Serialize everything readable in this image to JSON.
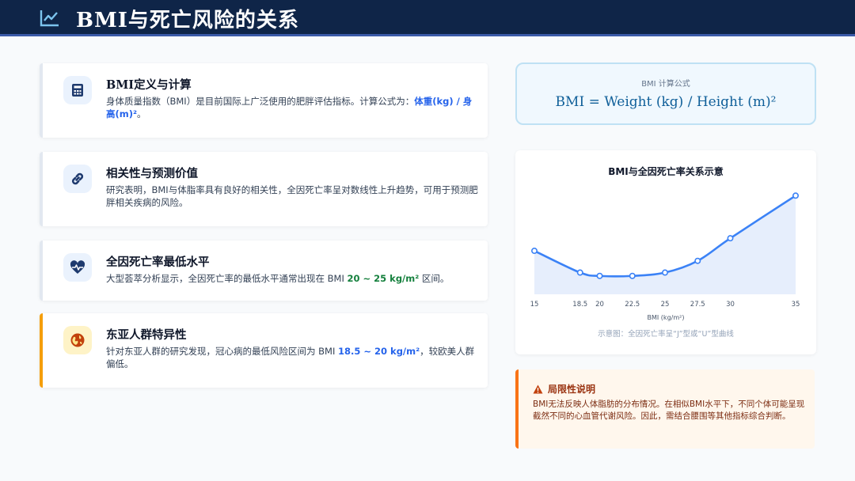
{
  "header": {
    "title": "BMI与死亡风险的关系",
    "icon": "chart-line-icon"
  },
  "cards": [
    {
      "icon": "calculator-icon",
      "title": "BMI定义与计算",
      "body_pre": "身体质量指数（BMI）是目前国际上广泛使用的肥胖评估指标。计算公式为：",
      "highlight": "体重(kg) / 身高(m)²",
      "body_post": "。"
    },
    {
      "icon": "link-icon",
      "title": "相关性与预测价值",
      "body": "研究表明，BMI与体脂率具有良好的相关性，全因死亡率呈对数线性上升趋势，可用于预测肥胖相关疾病的风险。"
    },
    {
      "icon": "heart-pulse-icon",
      "title": "全因死亡率最低水平",
      "body_pre": "大型荟萃分析显示，全因死亡率的最低水平通常出现在 BMI ",
      "highlight": "20 ~ 25 kg/m²",
      "body_post": " 区间。"
    },
    {
      "icon": "globe-asia-icon",
      "title": "东亚人群特异性",
      "body_pre": "针对东亚人群的研究发现，冠心病的最低风险区间为 BMI ",
      "highlight": "18.5 ~ 20 kg/m²",
      "body_post": "，较欧美人群偏低。"
    }
  ],
  "formula": {
    "label": "BMI 计算公式",
    "text": "BMI = Weight (kg) / Height (m)²"
  },
  "chart_data": {
    "type": "line",
    "title": "BMI与全因死亡率关系示意",
    "xlabel": "BMI (kg/m²)",
    "ylabel": "",
    "x": [
      15,
      18.5,
      20,
      22.5,
      25,
      27.5,
      30,
      35
    ],
    "series": [
      {
        "values": [
          1.34,
          1.08,
          1.04,
          1.04,
          1.08,
          1.22,
          1.49,
          2.0
        ]
      }
    ],
    "xlim": [
      15,
      35
    ],
    "ylim": [
      0.82,
      2.05
    ],
    "grid": false,
    "caption": "示意图：全因死亡率呈“J”型或“U”型曲线",
    "colors": {
      "line": "#3b82f6",
      "fill": "#e6eefc"
    }
  },
  "limitation": {
    "icon": "warning-icon",
    "title": "局限性说明",
    "body": "BMI无法反映人体脂肪的分布情况。在相似BMI水平下，不同个体可能呈现截然不同的心血管代谢风险。因此，需结合腰围等其他指标综合判断。"
  }
}
